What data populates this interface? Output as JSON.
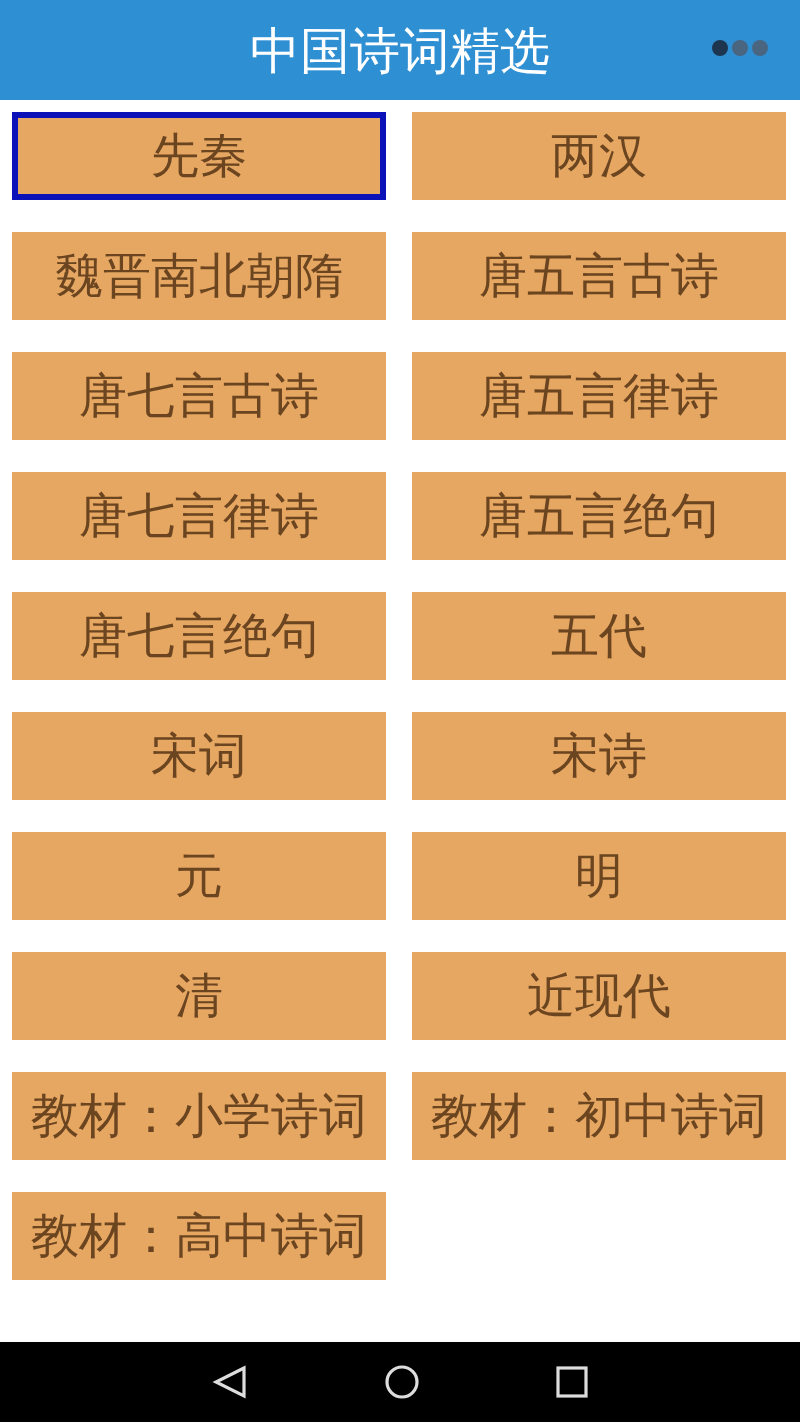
{
  "header": {
    "title": "中国诗词精选"
  },
  "categories": [
    {
      "label": "先秦",
      "selected": true
    },
    {
      "label": "两汉",
      "selected": false
    },
    {
      "label": "魏晋南北朝隋",
      "selected": false
    },
    {
      "label": "唐五言古诗",
      "selected": false
    },
    {
      "label": "唐七言古诗",
      "selected": false
    },
    {
      "label": "唐五言律诗",
      "selected": false
    },
    {
      "label": "唐七言律诗",
      "selected": false
    },
    {
      "label": "唐五言绝句",
      "selected": false
    },
    {
      "label": "唐七言绝句",
      "selected": false
    },
    {
      "label": "五代",
      "selected": false
    },
    {
      "label": "宋词",
      "selected": false
    },
    {
      "label": "宋诗",
      "selected": false
    },
    {
      "label": "元",
      "selected": false
    },
    {
      "label": "明",
      "selected": false
    },
    {
      "label": "清",
      "selected": false
    },
    {
      "label": "近现代",
      "selected": false
    },
    {
      "label": "教材：小学诗词",
      "selected": false
    },
    {
      "label": "教材：初中诗词",
      "selected": false
    },
    {
      "label": "教材：高中诗词",
      "selected": false
    }
  ]
}
